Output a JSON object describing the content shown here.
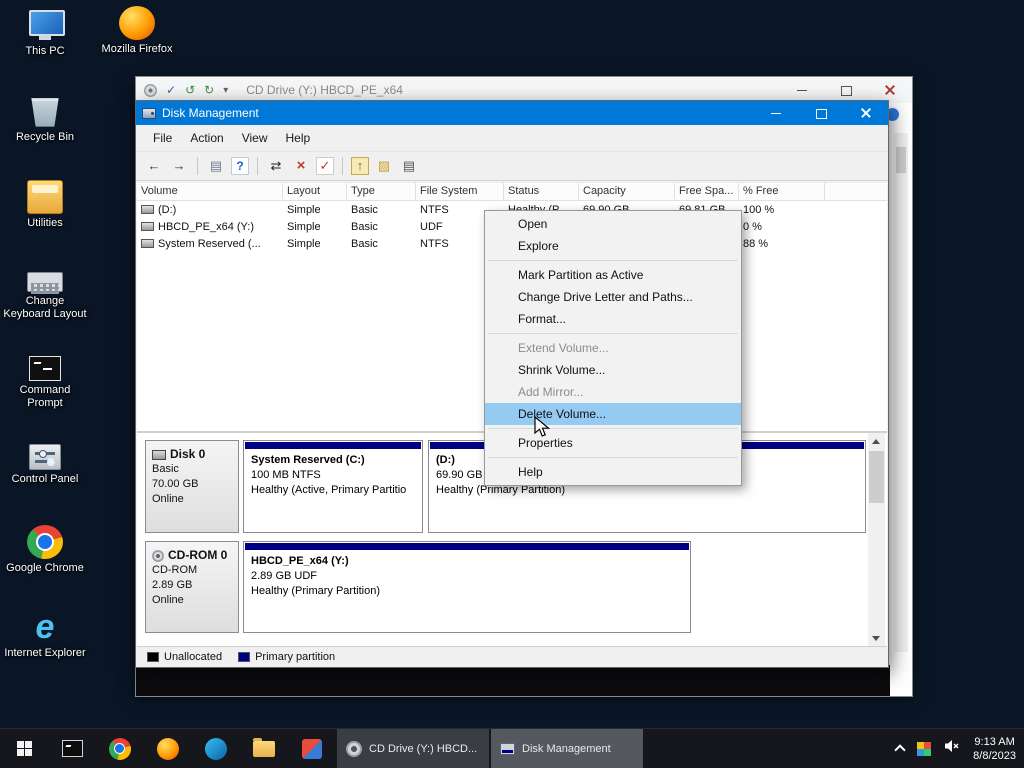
{
  "colors": {
    "titlebar": "#0078d7",
    "menu_highlight": "#95cbf2",
    "primary_partition": "#000082",
    "unallocated": "#000000",
    "desktop_background": "#0a1626"
  },
  "desktop": {
    "icons": [
      {
        "label": "This PC"
      },
      {
        "label": "Mozilla Firefox"
      },
      {
        "label": "Recycle Bin"
      },
      {
        "label": "Utilities"
      },
      {
        "label": "Change Keyboard Layout"
      },
      {
        "label": "Command Prompt"
      },
      {
        "label": "Control Panel"
      },
      {
        "label": "Google Chrome"
      },
      {
        "label": "Internet Explorer"
      }
    ]
  },
  "glyphs": {
    "ie": "e"
  },
  "explorer": {
    "title": "CD Drive (Y:) HBCD_PE_x64",
    "qat": [
      "✓",
      "↺",
      "↻",
      "▾"
    ]
  },
  "diskmgmt": {
    "title": "Disk Management",
    "menubar": [
      "File",
      "Action",
      "View",
      "Help"
    ],
    "toolbar": [
      "←",
      "→",
      "▤",
      "?",
      "⇄",
      "×",
      "✓",
      "↑",
      "▨",
      "▤"
    ],
    "columns": [
      "Volume",
      "Layout",
      "Type",
      "File System",
      "Status",
      "Capacity",
      "Free Spa...",
      "% Free"
    ],
    "rows": [
      {
        "volume": "(D:)",
        "layout": "Simple",
        "type": "Basic",
        "fs": "NTFS",
        "status": "Healthy (P...",
        "capacity": "69.90 GB",
        "free": "69.81 GB",
        "pct": "100 %"
      },
      {
        "volume": "HBCD_PE_x64 (Y:)",
        "layout": "Simple",
        "type": "Basic",
        "fs": "UDF",
        "status": "",
        "capacity": "",
        "free": "",
        "pct": "0 %"
      },
      {
        "volume": "System Reserved (...",
        "layout": "Simple",
        "type": "Basic",
        "fs": "NTFS",
        "status": "",
        "capacity": "",
        "free": "",
        "pct": "88 %"
      }
    ],
    "context_menu": [
      {
        "label": "Open",
        "state": "normal"
      },
      {
        "label": "Explore",
        "state": "normal"
      },
      {
        "label": "Mark Partition as Active",
        "state": "normal"
      },
      {
        "label": "Change Drive Letter and Paths...",
        "state": "normal"
      },
      {
        "label": "Format...",
        "state": "normal"
      },
      {
        "label": "Extend Volume...",
        "state": "disabled"
      },
      {
        "label": "Shrink Volume...",
        "state": "normal"
      },
      {
        "label": "Add Mirror...",
        "state": "disabled"
      },
      {
        "label": "Delete Volume...",
        "state": "highlighted"
      },
      {
        "label": "Properties",
        "state": "normal"
      },
      {
        "label": "Help",
        "state": "normal"
      }
    ],
    "disks": [
      {
        "name": "Disk 0",
        "type": "Basic",
        "size": "70.00 GB",
        "status": "Online",
        "partitions": [
          {
            "title": "System Reserved  (C:)",
            "size_line": "100 MB NTFS",
            "status_line": "Healthy (Active, Primary Partitio"
          },
          {
            "title": "(D:)",
            "size_line": "69.90 GB NTFS",
            "status_line": "Healthy (Primary Partition)"
          }
        ]
      },
      {
        "name": "CD-ROM 0",
        "type": "CD-ROM",
        "size": "2.89 GB",
        "status": "Online",
        "partitions": [
          {
            "title": "HBCD_PE_x64  (Y:)",
            "size_line": "2.89 GB UDF",
            "status_line": "Healthy (Primary Partition)"
          }
        ]
      }
    ],
    "legend": [
      {
        "label": "Unallocated",
        "color": "#000000"
      },
      {
        "label": "Primary partition",
        "color": "#000082"
      }
    ]
  },
  "taskbar": {
    "buttons": [
      {
        "label": "CD Drive (Y:) HBCD...",
        "active": false
      },
      {
        "label": "Disk Management",
        "active": true
      }
    ],
    "tray": {
      "time": "9:13 AM",
      "date": "8/8/2023"
    }
  }
}
